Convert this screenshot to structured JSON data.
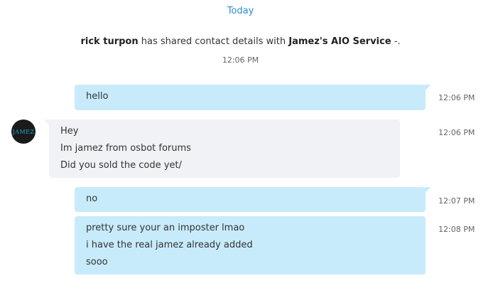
{
  "day_divider": "Today",
  "system_message": {
    "actor": "rick turpon",
    "action": "has shared contact details with",
    "target": "Jamez's AIO Service",
    "suffix": "-.",
    "time": "12:06 PM"
  },
  "messages": [
    {
      "direction": "outgoing",
      "lines": [
        "hello"
      ],
      "time": "12:06 PM"
    },
    {
      "direction": "incoming",
      "lines": [
        "Hey",
        "Im jamez from osbot forums",
        "Did you sold the code yet/"
      ],
      "time": "12:06 PM",
      "avatar_text": "JAMEZ"
    },
    {
      "direction": "outgoing",
      "lines": [
        "no"
      ],
      "time": "12:07 PM"
    },
    {
      "direction": "outgoing",
      "lines": [
        "pretty sure your an imposter lmao",
        "i have the real jamez already added",
        "sooo"
      ],
      "time": "12:08 PM"
    }
  ],
  "colors": {
    "accent": "#2f8dd1",
    "outgoing_bubble": "#c7ebfb",
    "incoming_bubble": "#f1f2f6",
    "avatar_bg": "#1a1a1a",
    "avatar_text": "#29a4d8"
  }
}
